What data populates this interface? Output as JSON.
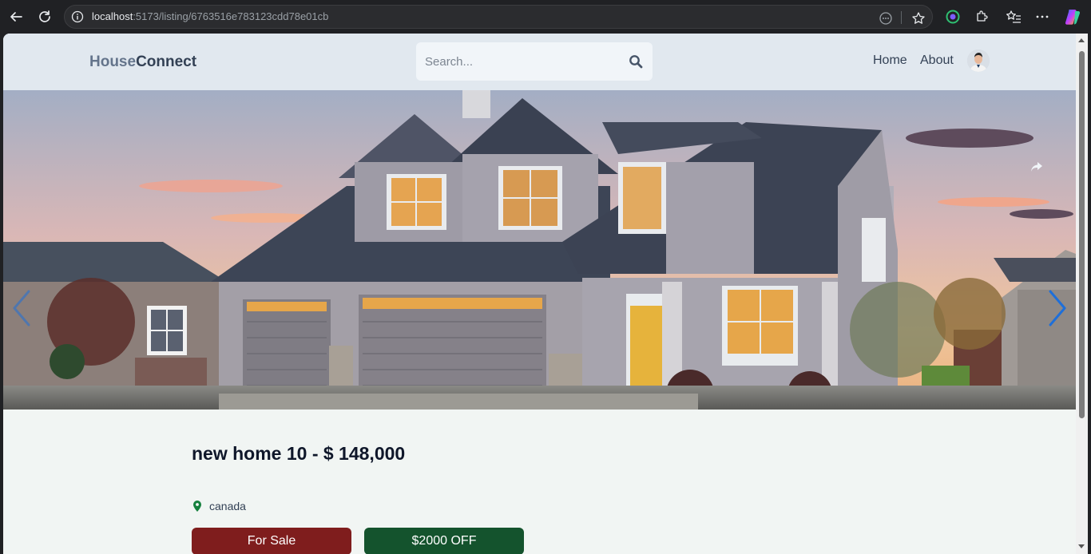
{
  "browser": {
    "url_host": "localhost",
    "url_path": ":5173/listing/6763516e783123cdd78e01cb"
  },
  "header": {
    "logo_part1": "House",
    "logo_part2": "Connect",
    "search_placeholder": "Search...",
    "nav": [
      {
        "label": "Home"
      },
      {
        "label": "About"
      }
    ]
  },
  "listing": {
    "title": "new home 10 - $ 148,000",
    "location": "canada",
    "type_badge": "For Sale",
    "discount_badge": "$2000 OFF"
  },
  "colors": {
    "header_bg": "#e1e8ef",
    "sale_badge": "#7f1d1d",
    "discount_badge": "#14532d",
    "carousel_arrow": "#1e6fd9",
    "location_pin": "#15803d"
  }
}
